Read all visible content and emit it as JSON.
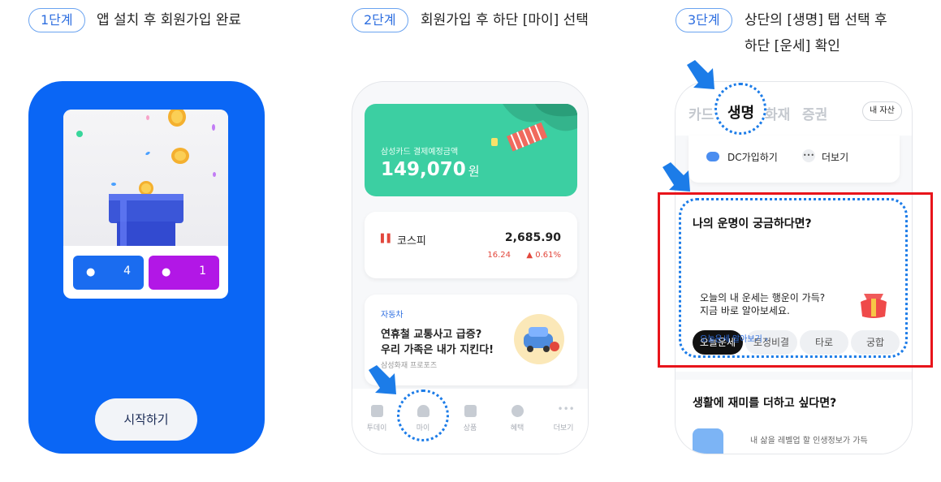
{
  "steps": [
    {
      "badge": "1단계",
      "text": "앱 설치 후 회원가입 완료"
    },
    {
      "badge": "2단계",
      "text": "회원가입 후 하단 [마이] 선택"
    },
    {
      "badge": "3단계",
      "text": "상단의 [생명] 탭 선택 후",
      "text2": "하단 [운세] 확인"
    }
  ],
  "phone1": {
    "btn_left_count": "4",
    "btn_right_count": "1",
    "start_label": "시작하기",
    "colors": {
      "bg": "#0a66f5",
      "btn_left": "#1a6cf0",
      "btn_right": "#b217e6"
    }
  },
  "phone2": {
    "payment_label": "삼성카드 결제예정금액",
    "payment_amount": "149,070",
    "payment_unit": "원",
    "kospi_label": "코스피",
    "kospi_value": "2,685.90",
    "kospi_change": "16.24",
    "kospi_change_pct": "▲ 0.61%",
    "promo_tag": "자동차",
    "promo_title_1": "연휴철 교통사고 급증?",
    "promo_title_2": "우리 가족은 내가 지킨다!",
    "promo_sub": "삼성화재 프로포즈",
    "tabs": [
      "투데이",
      "마이",
      "상품",
      "혜택",
      "더보기"
    ]
  },
  "phone3": {
    "top_tabs": [
      "카드",
      "생명",
      "화재",
      "증권"
    ],
    "my_assets": "내 자산",
    "dc_label": "DC가입하기",
    "more_label": "더보기",
    "fortune_title": "나의 운명이 궁금하다면?",
    "chips": [
      "오늘운세",
      "토정비결",
      "타로",
      "궁합"
    ],
    "fortune_line1": "오늘의 내 운세는 행운이 가득?",
    "fortune_line2": "지금 바로 알아보세요.",
    "fortune_link": "오늘운세 알아보기",
    "fun_title": "생활에 재미를 더하고 싶다면?",
    "fun_line1": "내 삶을 레벨업 할 인생정보가 가득"
  }
}
